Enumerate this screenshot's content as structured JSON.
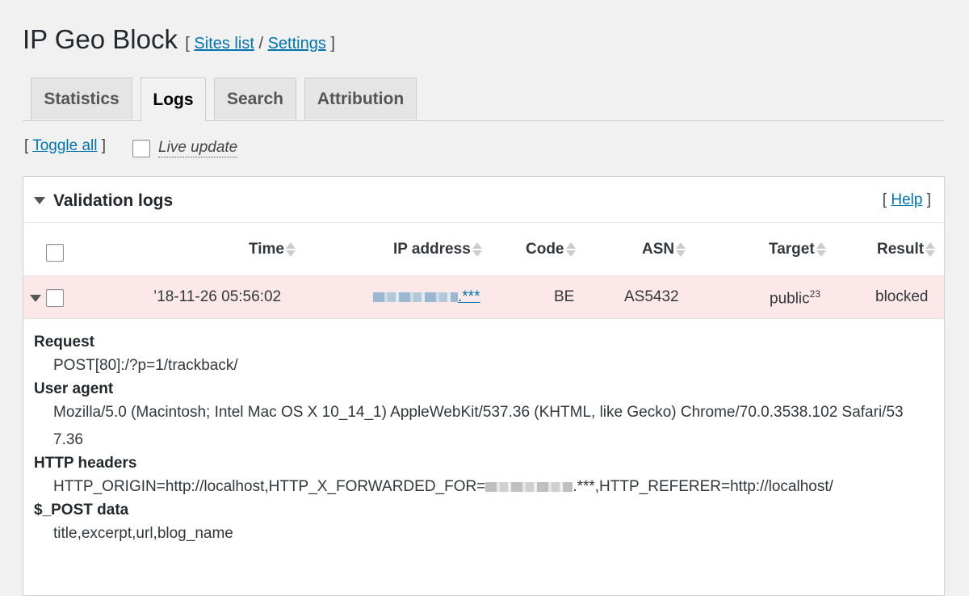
{
  "header": {
    "title": "IP Geo Block",
    "bracket_open": "[",
    "separator": "/",
    "bracket_close": "]",
    "sites_link": "Sites list",
    "settings_link": "Settings"
  },
  "tabs": [
    {
      "label": "Statistics",
      "active": false
    },
    {
      "label": "Logs",
      "active": true
    },
    {
      "label": "Search",
      "active": false
    },
    {
      "label": "Attribution",
      "active": false
    }
  ],
  "toolbar": {
    "bracket_open": "[",
    "toggle_all": "Toggle all",
    "bracket_close": "]",
    "live_update": "Live update"
  },
  "panel": {
    "title": "Validation logs",
    "help_open": "[",
    "help": "Help",
    "help_close": "]"
  },
  "table": {
    "columns": [
      "Time",
      "IP address",
      "Code",
      "ASN",
      "Target",
      "Result"
    ],
    "row": {
      "time": "’18-11-26 05:56:02",
      "ip_suffix": ".***",
      "code": "BE",
      "asn": "AS5432",
      "target": "public",
      "target_sup": "23",
      "result": "blocked"
    }
  },
  "details": {
    "request_label": "Request",
    "request_value": "POST[80]:/?p=1/trackback/",
    "ua_label": "User agent",
    "ua_value_line1": "Mozilla/5.0 (Macintosh; Intel Mac OS X 10_14_1) AppleWebKit/537.36 (KHTML, like Gecko) Chrome/70.0.3538.102 Safari/53",
    "ua_value_line2": "7.36",
    "headers_label": "HTTP headers",
    "headers_prefix": "HTTP_ORIGIN=http://localhost,HTTP_X_FORWARDED_FOR=",
    "headers_suffix": ".***,HTTP_REFERER=http://localhost/",
    "post_label": "$_POST data",
    "post_value": "title,excerpt,url,blog_name"
  }
}
